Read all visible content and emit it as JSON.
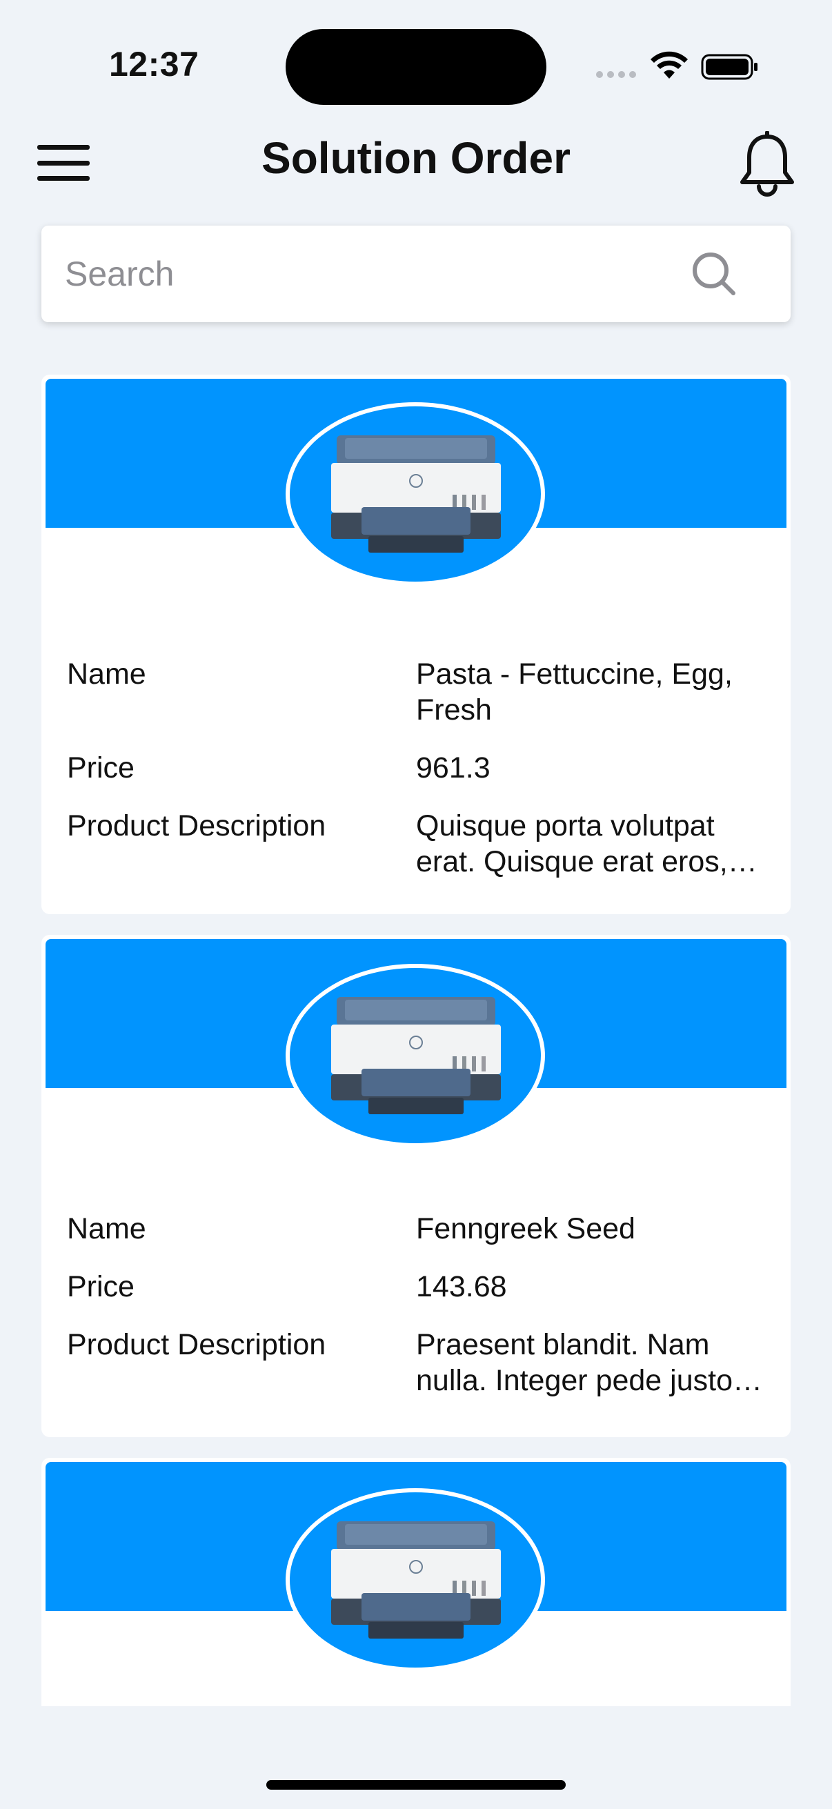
{
  "status": {
    "time": "12:37"
  },
  "header": {
    "title": "Solution Order"
  },
  "search": {
    "placeholder": "Search",
    "value": ""
  },
  "fields": {
    "name_label": "Name",
    "price_label": "Price",
    "description_label": "Product Description"
  },
  "products": [
    {
      "name": "Pasta - Fettuccine, Egg, Fresh",
      "price": "961.3",
      "description": "Quisque porta volutpat erat. Quisque erat eros, viverra eget, congue eget"
    },
    {
      "name": "Fenngreek Seed",
      "price": "143.68",
      "description": "Praesent blandit. Nam nulla. Integer pede justo, lacinia eget"
    },
    {
      "name": "",
      "price": "",
      "description": ""
    }
  ],
  "colors": {
    "accent": "#0194fe",
    "background": "#eff3f8",
    "card": "#ffffff"
  },
  "icons": {
    "menu": "hamburger-icon",
    "notifications": "bell-icon",
    "search": "search-icon",
    "product": "printer-image"
  }
}
